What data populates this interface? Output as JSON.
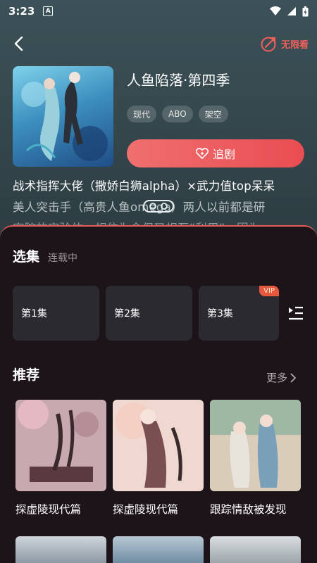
{
  "status_bar": {
    "time": "3:23",
    "app_badge": "A"
  },
  "header": {
    "unlimited_label": "无限看"
  },
  "show": {
    "title": "人鱼陷落·第四季",
    "tags": [
      "现代",
      "ABO",
      "架空"
    ],
    "follow_label": "追剧",
    "description_line1": "战术指挥大佬（撒娇白狮alpha）×武力值top呆呆",
    "description_line2": "美人突击手（高贵人鱼omega）两人以前都是研",
    "description_line3": "究院的实验体，相依为命但又相互“利用”，因为"
  },
  "episodes_section": {
    "title": "选集",
    "status": "连载中",
    "episodes": [
      {
        "label": "第1集",
        "vip": false
      },
      {
        "label": "第2集",
        "vip": false
      },
      {
        "label": "第3集",
        "vip": true
      }
    ],
    "vip_label": "VIP"
  },
  "recommend_section": {
    "title": "推荐",
    "more_label": "更多",
    "items": [
      {
        "title": "探虚陵现代篇",
        "cover_color": "#c9a9b0"
      },
      {
        "title": "探虚陵现代篇",
        "cover_color": "#e8c7c0"
      },
      {
        "title": "跟踪情敌被发现",
        "cover_color": "#d9ccb8"
      }
    ]
  },
  "colors": {
    "accent": "#e94d52",
    "sheet_bg": "#1c1419",
    "card_bg": "#2b2a30"
  }
}
